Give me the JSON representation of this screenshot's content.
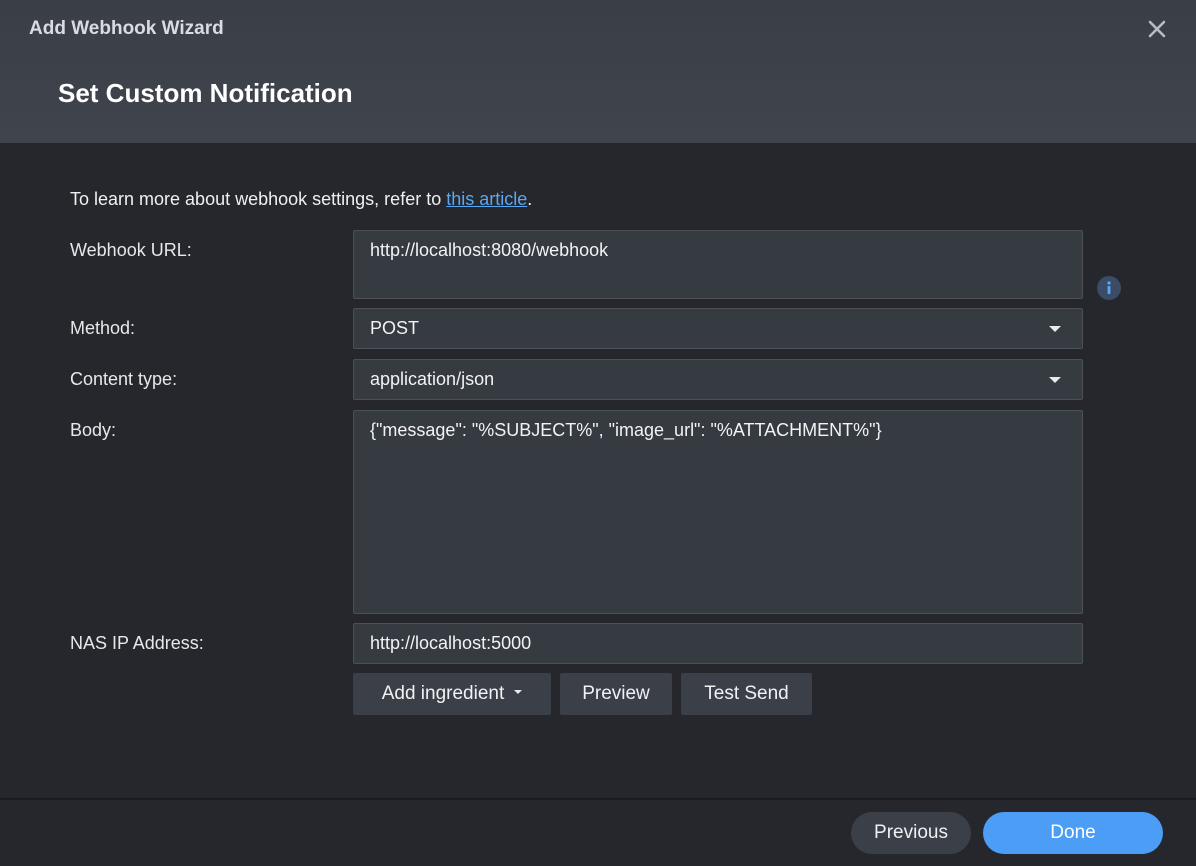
{
  "window": {
    "title": "Add Webhook Wizard",
    "step_title": "Set Custom Notification"
  },
  "intro": {
    "text": "To learn more about webhook settings, refer to ",
    "link_text": "this article",
    "suffix": "."
  },
  "form": {
    "webhook_url": {
      "label": "Webhook URL:",
      "value": "http://localhost:8080/webhook"
    },
    "method": {
      "label": "Method:",
      "value": "POST"
    },
    "content_type": {
      "label": "Content type:",
      "value": "application/json"
    },
    "body": {
      "label": "Body:",
      "value": "{\"message\": \"%SUBJECT%\", \"image_url\": \"%ATTACHMENT%\"}"
    },
    "nas_ip": {
      "label": "NAS IP Address:",
      "value": "http://localhost:5000"
    }
  },
  "actions": {
    "add_ingredient": "Add ingredient",
    "preview": "Preview",
    "test_send": "Test Send"
  },
  "footer": {
    "previous": "Previous",
    "done": "Done"
  },
  "icons": {
    "close": "close-icon",
    "info": "info-icon",
    "dropdown": "chevron-down-icon"
  },
  "colors": {
    "accent": "#4b9df6",
    "link": "#5aa7f2",
    "background": "#25272c",
    "header": "#3d4149"
  }
}
